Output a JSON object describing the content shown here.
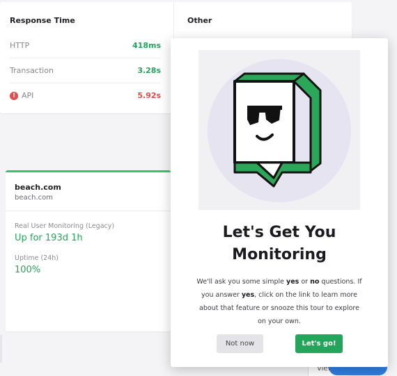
{
  "response_time": {
    "title": "Response Time",
    "metrics": [
      {
        "label": "HTTP",
        "value": "418ms",
        "status": "good"
      },
      {
        "label": "Transaction",
        "value": "3.28s",
        "status": "good"
      },
      {
        "label": "API",
        "value": "5.92s",
        "status": "alert"
      }
    ]
  },
  "other": {
    "title": "Other"
  },
  "monitor": {
    "name": "beach.com",
    "url": "beach.com",
    "rum_label": "Real User Monitoring (Legacy)",
    "rum_value": "Up for 193d 1h",
    "uptime_label": "Uptime (24h)",
    "uptime_value": "100%"
  },
  "popup": {
    "title_line1": "Let's Get You",
    "title_line2": "Monitoring",
    "body": {
      "p1": "We'll ask you some simple ",
      "yes": "yes",
      "or": " or ",
      "no": "no",
      "p2": " questions. If you answer ",
      "yes2": "yes",
      "p3": ", click on the link to learn more about that feature or snooze this tour to explore on your own."
    },
    "not_now_label": "Not now",
    "go_label": "Let's go!"
  },
  "background": {
    "view_label": "View"
  },
  "colors": {
    "accent_green": "#25a55b",
    "good": "#2aa05c",
    "alert": "#e04a4a",
    "mascot_green": "#2ca659"
  },
  "icons": [
    "alert-circle-icon",
    "mascot-illustration"
  ]
}
